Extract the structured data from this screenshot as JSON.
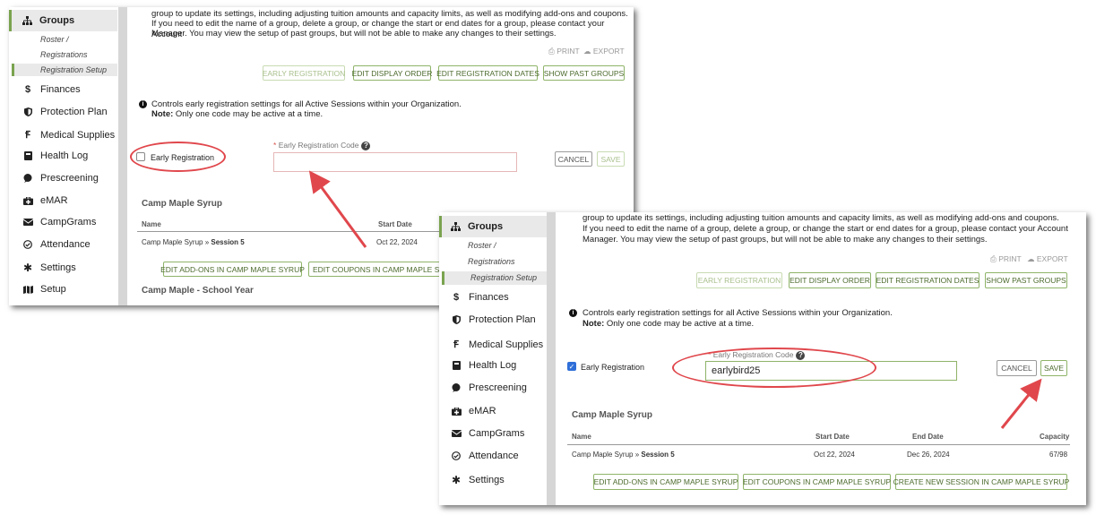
{
  "sidebar": {
    "groups_label": "Groups",
    "sub_items": [
      "Roster /",
      "Registrations",
      "Registration Setup"
    ],
    "items": [
      {
        "label": "Finances",
        "icon": "dollar-icon"
      },
      {
        "label": "Protection Plan",
        "icon": "shield-icon"
      },
      {
        "label": "Medical Supplies",
        "icon": "stethoscope-icon"
      },
      {
        "label": "Health Log",
        "icon": "book-icon"
      },
      {
        "label": "Prescreening",
        "icon": "chat-bubble-icon"
      },
      {
        "label": "eMAR",
        "icon": "medical-kit-icon"
      },
      {
        "label": "CampGrams",
        "icon": "envelope-icon"
      },
      {
        "label": "Attendance",
        "icon": "check-circle-icon"
      },
      {
        "label": "Settings",
        "icon": "gear-icon"
      },
      {
        "label": "Setup",
        "icon": "map-icon"
      }
    ]
  },
  "shot1": {
    "intro_lines": [
      "group to update its settings, including adjusting tuition amounts and capacity limits, as well as modifying add-ons and coupons.",
      "If you need to edit the name of a group, delete a group, or change the start or end dates for a group, please contact your Account",
      "Manager. You may view the setup of past groups, but will not be able to make any changes to their settings."
    ]
  },
  "shot2": {
    "intro_lines": [
      "group to update its settings, including adjusting tuition amounts and capacity limits, as well as modifying add-ons and coupons.",
      "If you need to edit the name of a group, delete a group, or change the start or end dates for a group, please contact your Account",
      "Manager. You may view the setup of past groups, but will not be able to make any changes to their settings."
    ],
    "code_value": "earlybird25"
  },
  "toolbar": {
    "print": "PRINT",
    "export": "EXPORT"
  },
  "actions": {
    "early_registration": "EARLY REGISTRATION",
    "edit_display_order": "EDIT DISPLAY ORDER",
    "edit_registration_dates": "EDIT REGISTRATION DATES",
    "show_past_groups": "SHOW PAST GROUPS"
  },
  "info": {
    "line1": "Controls early registration settings for all Active Sessions within your Organization.",
    "note_bold": "Note:",
    "note_text": " Only one code may be active at a time."
  },
  "early_reg": {
    "checkbox_label": "Early Registration",
    "code_label": "Early Registration Code",
    "required_mark": "*",
    "cancel": "CANCEL",
    "save": "SAVE"
  },
  "camp": {
    "title": "Camp Maple Syrup",
    "columns": [
      "Name",
      "Start Date",
      "End Date",
      "Capacity"
    ],
    "row": {
      "name": "Camp Maple Syrup",
      "sep": " » ",
      "session": "Session 5",
      "start": "Oct 22, 2024",
      "end": "Dec 26, 2024",
      "capacity": "67/98"
    },
    "btn_addons": "EDIT ADD-ONS IN CAMP MAPLE SYRUP",
    "btn_coupons": "EDIT COUPONS IN CAMP MAPLE SYRUP",
    "btn_coupons_cut": "EDIT COUPONS IN CAMP MAPLE SYR",
    "btn_new_session": "CREATE NEW SESSION IN CAMP MAPLE SYRUP",
    "next_group_title": "Camp Maple - School Year"
  },
  "colors": {
    "accent": "#7aa34f",
    "annotation": "#e0474c"
  }
}
